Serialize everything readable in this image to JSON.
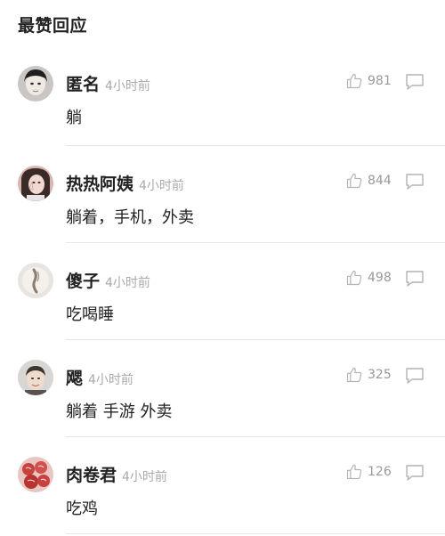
{
  "header": {
    "title": "最赞回应"
  },
  "comments": [
    {
      "name": "匿名",
      "time": "4小时前",
      "text": "躺",
      "likes": "981",
      "avatar": {
        "bg": "#c9c6c3",
        "fg": "#2b2b2b"
      }
    },
    {
      "name": "热热阿姨",
      "time": "4小时前",
      "text": "躺着，手机，外卖",
      "likes": "844",
      "avatar": {
        "bg": "#d9b7b0",
        "fg": "#3a2a28"
      }
    },
    {
      "name": "傻子",
      "time": "4小时前",
      "text": "吃喝睡",
      "likes": "498",
      "avatar": {
        "bg": "#e8e4df",
        "fg": "#8b7d72"
      }
    },
    {
      "name": "飔",
      "time": "4小时前",
      "text": "躺着 手游 外卖",
      "likes": "325",
      "avatar": {
        "bg": "#d8d6d2",
        "fg": "#3c3631"
      }
    },
    {
      "name": "肉卷君",
      "time": "4小时前",
      "text": "吃鸡",
      "likes": "126",
      "avatar": {
        "bg": "#e7c6c4",
        "fg": "#c8413f"
      }
    }
  ],
  "colors": {
    "name": "#222222",
    "time": "#aaaaaa",
    "count": "#999999",
    "icon": "#b3b3b3",
    "divider": "#e6e6e6"
  },
  "icons": {
    "like": "thumbs-up-icon",
    "reply": "comment-bubble-icon"
  }
}
